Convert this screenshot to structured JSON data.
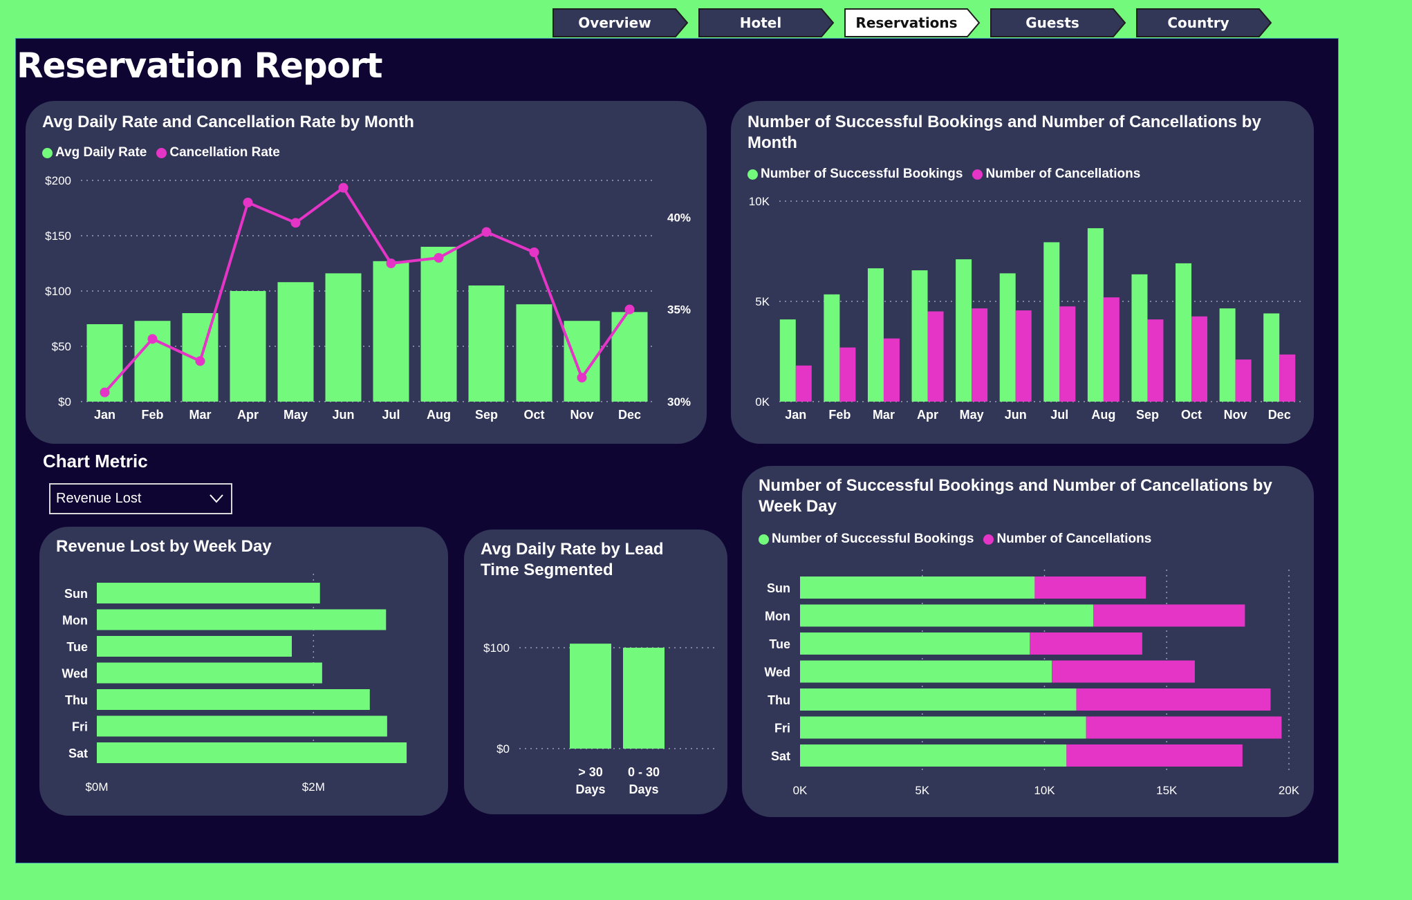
{
  "nav": {
    "tabs": [
      {
        "label": "Overview",
        "active": false
      },
      {
        "label": "Hotel",
        "active": false
      },
      {
        "label": "Reservations",
        "active": true
      },
      {
        "label": "Guests",
        "active": false
      },
      {
        "label": "Country",
        "active": false
      }
    ]
  },
  "page": {
    "title": "Reservation Report"
  },
  "filter": {
    "label": "Chart Metric",
    "selected": "Revenue Lost",
    "icon": "chevron-down-icon"
  },
  "colors": {
    "green": "#73f97c",
    "magenta": "#e535c7",
    "card": "#323657",
    "canvas": "#0e0533"
  },
  "chart_data": [
    {
      "id": "adr_cancel_month",
      "type": "bar",
      "title": "Avg Daily Rate and Cancellation Rate by Month",
      "legend": [
        "Avg Daily Rate",
        "Cancellation Rate"
      ],
      "categories": [
        "Jan",
        "Feb",
        "Mar",
        "Apr",
        "May",
        "Jun",
        "Jul",
        "Aug",
        "Sep",
        "Oct",
        "Nov",
        "Dec"
      ],
      "series": [
        {
          "name": "Avg Daily Rate",
          "type": "bar",
          "values": [
            70,
            73,
            80,
            100,
            108,
            116,
            127,
            140,
            105,
            88,
            73,
            81
          ]
        },
        {
          "name": "Cancellation Rate",
          "type": "line",
          "axis": "right",
          "values": [
            30.5,
            33.4,
            32.2,
            40.8,
            39.7,
            41.6,
            37.5,
            37.8,
            39.2,
            38.1,
            31.3,
            35.0
          ]
        }
      ],
      "ylim": [
        0,
        200
      ],
      "yticks": [
        "$0",
        "$50",
        "$100",
        "$150",
        "$200"
      ],
      "y2lim": [
        30,
        42
      ],
      "y2ticks": [
        "30%",
        "35%",
        "40%"
      ],
      "grid": true,
      "legend_position": "top-left"
    },
    {
      "id": "bookings_month",
      "type": "bar",
      "title": "Number of Successful Bookings and Number of Cancellations by Month",
      "legend": [
        "Number of Successful Bookings",
        "Number of Cancellations"
      ],
      "categories": [
        "Jan",
        "Feb",
        "Mar",
        "Apr",
        "May",
        "Jun",
        "Jul",
        "Aug",
        "Sep",
        "Oct",
        "Nov",
        "Dec"
      ],
      "series": [
        {
          "name": "Number of Successful Bookings",
          "values": [
            4100,
            5350,
            6650,
            6550,
            7100,
            6400,
            7950,
            8650,
            6350,
            6900,
            4650,
            4400
          ]
        },
        {
          "name": "Number of Cancellations",
          "values": [
            1800,
            2700,
            3150,
            4500,
            4650,
            4550,
            4750,
            5200,
            4100,
            4250,
            2100,
            2350
          ]
        }
      ],
      "ylim": [
        0,
        10000
      ],
      "yticks": [
        "0K",
        "5K",
        "10K"
      ],
      "grid": true,
      "legend_position": "top-left"
    },
    {
      "id": "revenue_lost_weekday",
      "type": "bar",
      "orientation": "horizontal",
      "title": "Revenue Lost by Week Day",
      "categories": [
        "Sun",
        "Mon",
        "Tue",
        "Wed",
        "Thu",
        "Fri",
        "Sat"
      ],
      "values": [
        2.06,
        2.67,
        1.8,
        2.08,
        2.52,
        2.68,
        2.86
      ],
      "xlim": [
        0,
        3.0
      ],
      "xticks": [
        "$0M",
        "$2M"
      ],
      "unit": "$M"
    },
    {
      "id": "adr_lead_time",
      "type": "bar",
      "title": "Avg Daily Rate by Lead Time Segmented",
      "categories": [
        "> 30 Days",
        "0 - 30 Days"
      ],
      "values": [
        104,
        100
      ],
      "ylim": [
        0,
        100
      ],
      "yticks": [
        "$0",
        "$100"
      ]
    },
    {
      "id": "bookings_weekday",
      "type": "bar",
      "orientation": "horizontal",
      "stacked": true,
      "title": "Number of Successful Bookings and Number of Cancellations by Week Day",
      "legend": [
        "Number of Successful Bookings",
        "Number of Cancellations"
      ],
      "categories": [
        "Sun",
        "Mon",
        "Tue",
        "Wed",
        "Thu",
        "Fri",
        "Sat"
      ],
      "series": [
        {
          "name": "Number of Successful Bookings",
          "values": [
            9600,
            12000,
            9400,
            10300,
            11300,
            11700,
            10900
          ]
        },
        {
          "name": "Number of Cancellations",
          "values": [
            4550,
            6200,
            4600,
            5850,
            7950,
            8000,
            7200
          ]
        }
      ],
      "xlim": [
        0,
        20000
      ],
      "xticks": [
        "0K",
        "5K",
        "10K",
        "15K",
        "20K"
      ],
      "grid": true,
      "legend_position": "top-left"
    }
  ]
}
